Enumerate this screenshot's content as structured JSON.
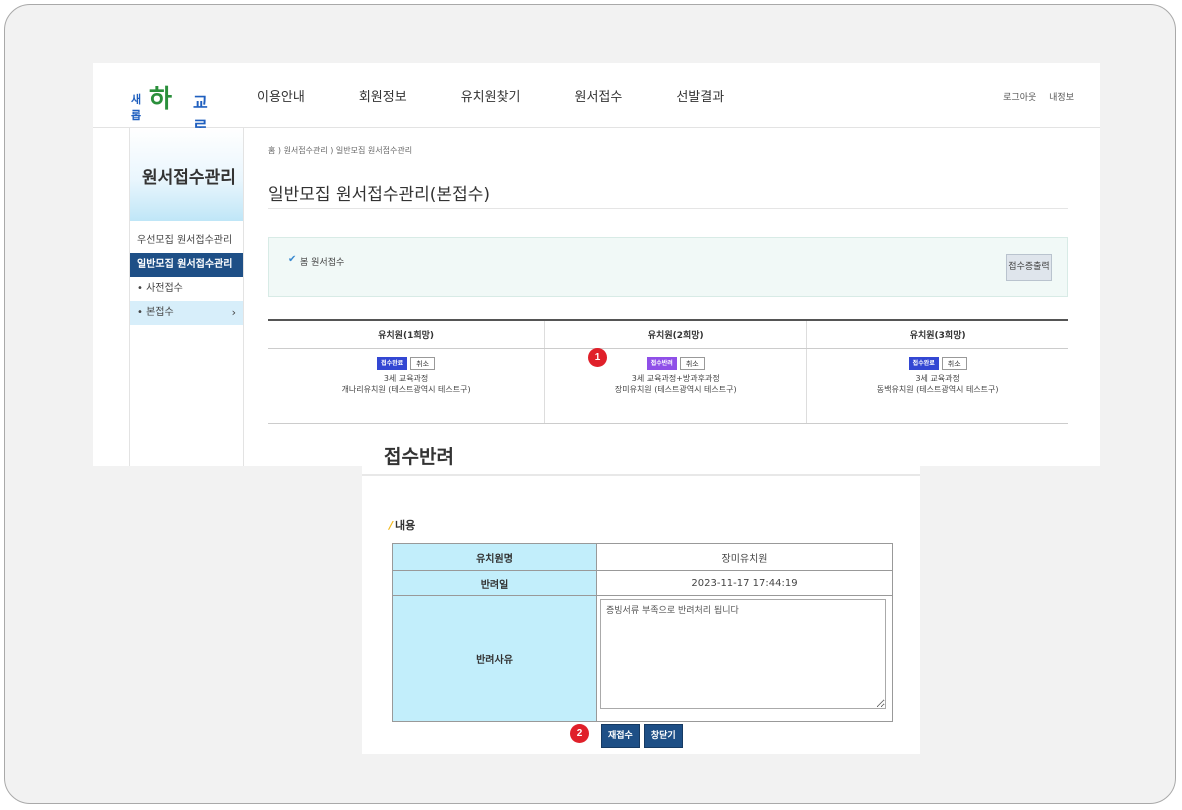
{
  "header": {
    "logo": {
      "small": "새롭",
      "big_green": "하",
      "big_yellow": "",
      "tail": "교로"
    },
    "nav": [
      "이용안내",
      "회원정보",
      "유치원찾기",
      "원서접수",
      "선발결과"
    ],
    "util": [
      "로그아웃",
      "내정보"
    ]
  },
  "sidebar": {
    "title": "원서접수관리",
    "items": [
      {
        "label": "우선모집 원서접수관리"
      },
      {
        "label": "일반모집 원서접수관리"
      }
    ],
    "subitems": [
      {
        "label": "• 사전접수"
      },
      {
        "label": "• 본접수",
        "arrow": "›"
      }
    ]
  },
  "main": {
    "breadcrumb": "홈 ) 원서접수관리 ) 일반모집 원서접수관리",
    "title": "일반모집 원서접수관리(본접수)",
    "notice": {
      "label": "봄 원서접수",
      "button": "접수증출력"
    },
    "choices": {
      "headers": [
        "유치원(1희망)",
        "유치원(2희망)",
        "유치원(3희망)"
      ],
      "cells": [
        {
          "status": "접수완료",
          "cancel": "취소",
          "course": "3세 교육과정",
          "school": "개나리유치원 (테스트광역시 테스트구)"
        },
        {
          "status": "접수반려",
          "cancel": "취소",
          "course": "3세 교육과정+방과후과정",
          "school": "장미유치원 (테스트광역시 테스트구)"
        },
        {
          "status": "접수완료",
          "cancel": "취소",
          "course": "3세 교육과정",
          "school": "동백유치원 (테스트광역시 테스트구)"
        }
      ]
    }
  },
  "popup": {
    "title": "접수반려",
    "section": "내용",
    "rows": [
      {
        "label": "유치원명",
        "value": "장미유치원"
      },
      {
        "label": "반려일",
        "value": "2023-11-17 17:44:19"
      },
      {
        "label": "반려사유",
        "value": "증빙서류 부족으로 반려처리 됩니다"
      }
    ],
    "buttons": [
      "재접수",
      "창닫기"
    ]
  },
  "markers": [
    "1",
    "2"
  ],
  "colors": {
    "badge_done": "#3347d3",
    "badge_rejected": "#8f4fe8",
    "nav_active_bg": "#1e4f86",
    "marker": "#e0202a",
    "table_header_bg": "#c2eefb"
  }
}
